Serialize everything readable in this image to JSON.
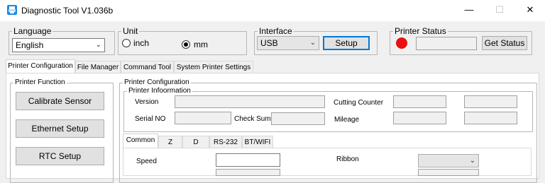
{
  "window": {
    "title": "Diagnostic Tool V1.036b",
    "controls": [
      "—",
      "☐",
      "✕"
    ]
  },
  "language": {
    "label": "Language",
    "value": "English"
  },
  "unit": {
    "label": "Unit",
    "options": [
      "inch",
      "mm"
    ],
    "selected": "mm"
  },
  "interface": {
    "label": "Interface",
    "value": "USB",
    "setup_label": "Setup"
  },
  "printer_status": {
    "label": "Printer  Status",
    "get_status_label": "Get Status",
    "led_color": "#e81010"
  },
  "tabs": [
    "Printer Configuration",
    "File Manager",
    "Command Tool",
    "System Printer Settings"
  ],
  "printer_function": {
    "label": "Printer  Function",
    "buttons": [
      "Calibrate Sensor",
      "Ethernet Setup",
      "RTC Setup"
    ]
  },
  "printer_configuration": {
    "label": "Printer Configuration",
    "info_label": "Printer Infoormation",
    "version_label": "Version",
    "cutting_counter_label": "Cutting Counter",
    "serial_label": "Serial NO",
    "checksum_label": "Check Sum",
    "mileage_label": "Mileage"
  },
  "sub_tabs": [
    "Common",
    "Z",
    "D",
    "RS-232",
    "BT/WIFI"
  ],
  "common": {
    "speed_label": "Speed",
    "ribbon_label": "Ribbon"
  }
}
